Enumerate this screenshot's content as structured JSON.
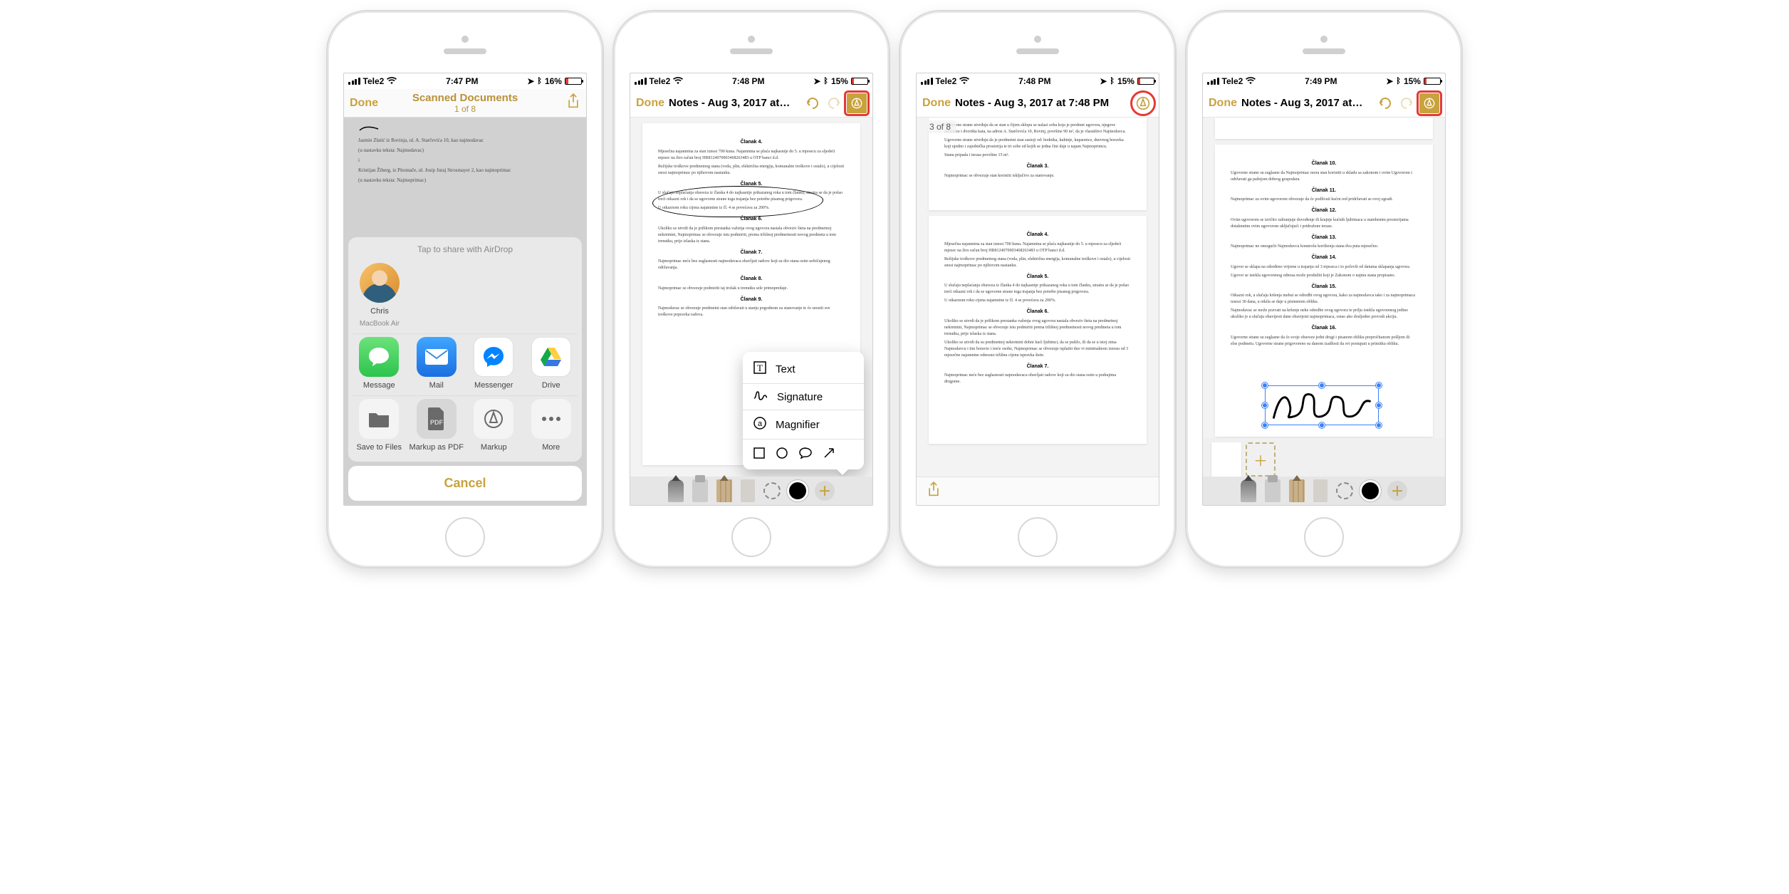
{
  "colors": {
    "accent": "#c8a23d",
    "highlight": "#e53935",
    "selection": "#3b82f6"
  },
  "screens": [
    {
      "status": {
        "carrier": "Tele2",
        "time": "7:47 PM",
        "battery_pct": "16%"
      },
      "nav": {
        "done": "Done",
        "title": "Scanned Documents",
        "subtitle": "1 of 8"
      },
      "share": {
        "airdrop_hint": "Tap to share with AirDrop",
        "contact_name": "Chris",
        "contact_device": "MacBook Air",
        "apps": [
          "Message",
          "Mail",
          "Messenger",
          "Drive"
        ],
        "actions": [
          "Save to Files",
          "Markup as PDF",
          "Markup",
          "More"
        ],
        "cancel": "Cancel"
      },
      "doc_lines": [
        "Jasmin Zlatić iz Rovinja, ul. A. Starčevića 10, kao najmodavac",
        "(u nastavku teksta: Najmodavac)",
        "i",
        "Kristijan Žiberg, iz Pitomače, ul. Josip Juraj Strosmayer 2, kao najmoprimac",
        "(u nastavku teksta: Najmoprimac)"
      ]
    },
    {
      "status": {
        "carrier": "Tele2",
        "time": "7:48 PM",
        "battery_pct": "15%"
      },
      "nav": {
        "done": "Done",
        "title": "Notes - Aug 3, 2017 at…"
      },
      "popover": {
        "items": [
          "Text",
          "Signature",
          "Magnifier"
        ],
        "shapes": [
          "square",
          "circle",
          "speech-bubble",
          "arrow"
        ]
      },
      "doc_sections": [
        "Članak 4.",
        "Članak 5.",
        "Članak 6.",
        "Članak 7.",
        "Članak 8.",
        "Članak 9."
      ]
    },
    {
      "status": {
        "carrier": "Tele2",
        "time": "7:48 PM",
        "battery_pct": "15%"
      },
      "nav": {
        "done": "Done",
        "title": "Notes - Aug 3, 2017 at 7:48 PM"
      },
      "page_counter": "3 of 8",
      "doc_sections_top": [
        "Članak 3."
      ],
      "doc_sections_btm": [
        "Članak 4.",
        "Članak 5.",
        "Članak 6.",
        "Članak 7."
      ]
    },
    {
      "status": {
        "carrier": "Tele2",
        "time": "7:49 PM",
        "battery_pct": "15%"
      },
      "nav": {
        "done": "Done",
        "title": "Notes - Aug 3, 2017 at…"
      },
      "doc_sections": [
        "Članak 10.",
        "Članak 11.",
        "Članak 12.",
        "Članak 13.",
        "Članak 14.",
        "Članak 15.",
        "Članak 16."
      ]
    }
  ]
}
